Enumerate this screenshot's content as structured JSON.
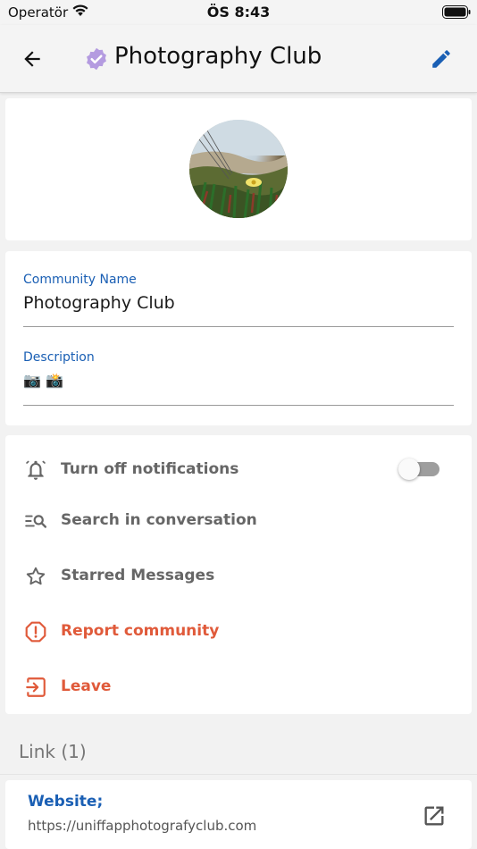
{
  "status_bar": {
    "carrier": "Operatör",
    "time": "ÖS 8:43"
  },
  "app_bar": {
    "title": "Photography Club",
    "back_icon": "arrow-left-icon",
    "verified_icon": "verified-badge-icon",
    "edit_icon": "pencil-icon",
    "accent_color": "#1a5fb4",
    "verified_color": "#b49be0"
  },
  "avatar": {
    "icon": "community-photo"
  },
  "fields": {
    "name_label": "Community Name",
    "name_value": "Photography Club",
    "description_label": "Description",
    "description_value": "📷 📸"
  },
  "actions": [
    {
      "label": "Turn off notifications",
      "icon": "bell-off-icon"
    },
    {
      "label": "Search in conversation",
      "icon": "search-list-icon"
    },
    {
      "label": "Starred Messages",
      "icon": "star-icon"
    },
    {
      "label": "Report community",
      "icon": "report-icon"
    },
    {
      "label": "Leave",
      "icon": "exit-icon"
    }
  ],
  "notifications_toggle": {
    "on": false
  },
  "danger_color": "#e05a3a",
  "links": {
    "header": "Link (1)",
    "items": [
      {
        "title": "Website;",
        "url": "https://uniffapphotografyclub.com"
      }
    ]
  }
}
